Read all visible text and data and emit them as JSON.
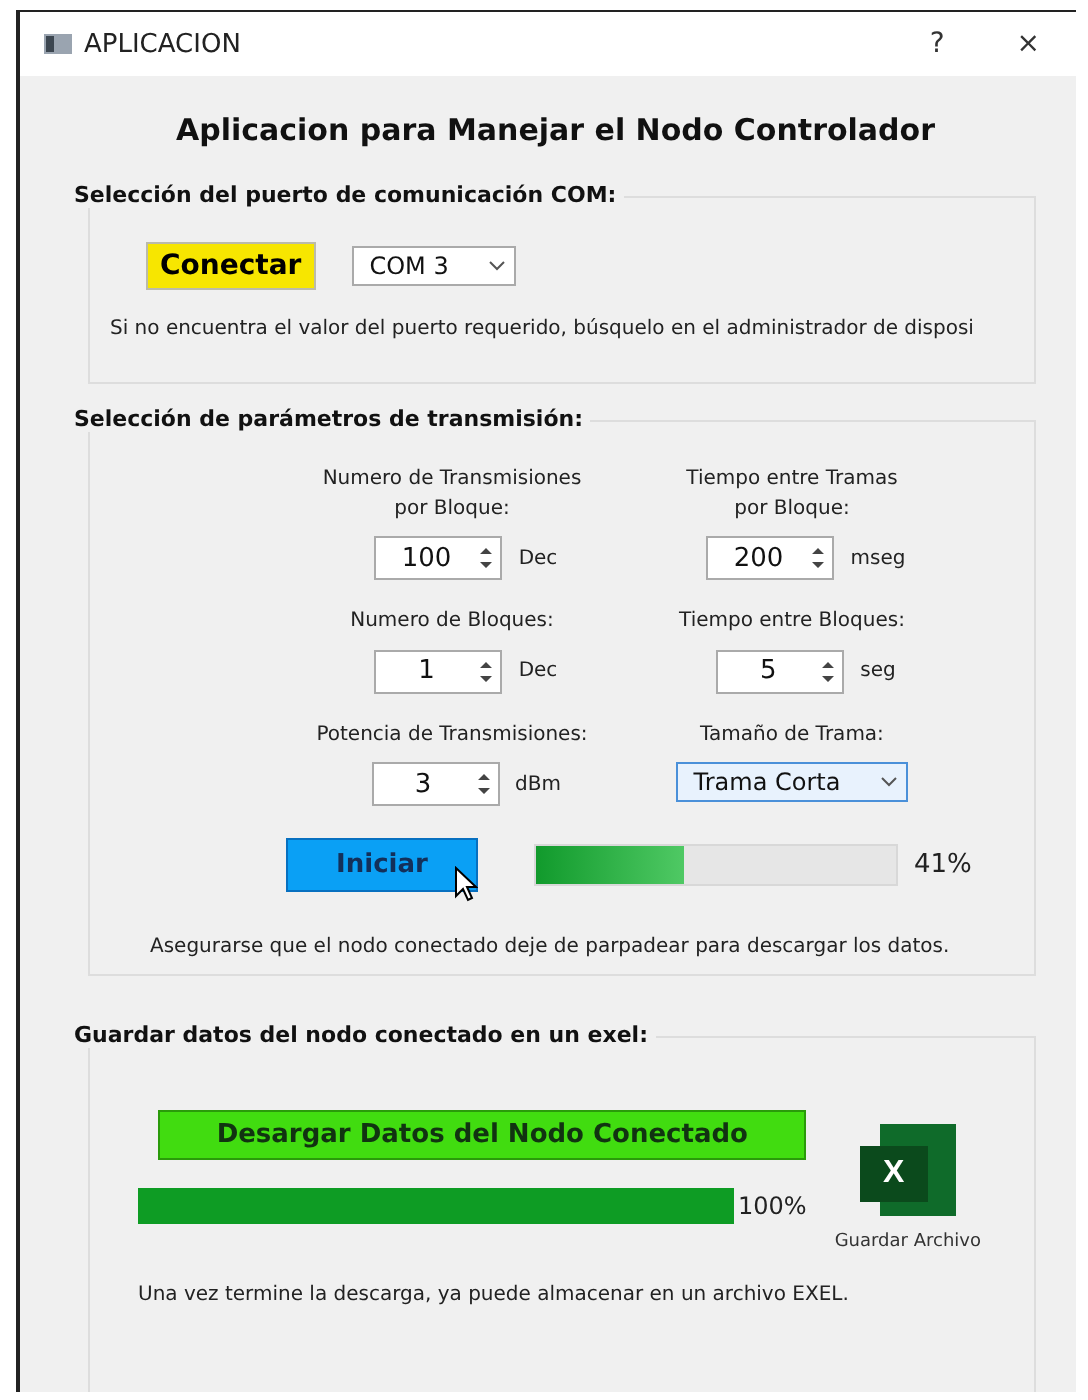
{
  "window": {
    "title": "APLICACION",
    "help": "?",
    "close": "×"
  },
  "heading": "Aplicacion para Manejar el Nodo Controlador",
  "port_group": {
    "title": "Selección del puerto de comunicación COM:",
    "connect_button": "Conectar",
    "port": "COM 3",
    "hint": "Si no encuentra el valor del puerto requerido, búsquelo en el administrador de disposi"
  },
  "params_group": {
    "title": "Selección de parámetros de transmisión:",
    "fields": [
      {
        "kind": "spin",
        "label": "Numero de Transmisiones\npor Bloque:",
        "value": "100",
        "unit": "Dec"
      },
      {
        "kind": "spin",
        "label": "Tiempo entre Tramas\npor Bloque:",
        "value": "200",
        "unit": "mseg"
      },
      {
        "kind": "spin",
        "label": "Numero de Bloques:",
        "value": "1",
        "unit": "Dec"
      },
      {
        "kind": "spin",
        "label": "Tiempo entre Bloques:",
        "value": "5",
        "unit": "seg"
      },
      {
        "kind": "spin",
        "label": "Potencia de Transmisiones:",
        "value": "3",
        "unit": "dBm"
      },
      {
        "kind": "combo",
        "label": "Tamaño de Trama:",
        "value": "Trama Corta"
      }
    ],
    "start_button": "Iniciar",
    "progress": {
      "level": 0.41,
      "reading": "41%"
    },
    "note": "Asegurarse que el nodo conectado deje de parpadear para descargar los datos."
  },
  "save_group": {
    "title": "Guardar datos del nodo conectado en un exel:",
    "download_button": "Desargar Datos del Nodo Conectado",
    "progress": {
      "level": 1.0,
      "reading": "100%"
    },
    "excel_letter": "X",
    "save_label": "Guardar Archivo",
    "note": "Una vez termine la descarga, ya puede almacenar en un archivo EXEL."
  }
}
